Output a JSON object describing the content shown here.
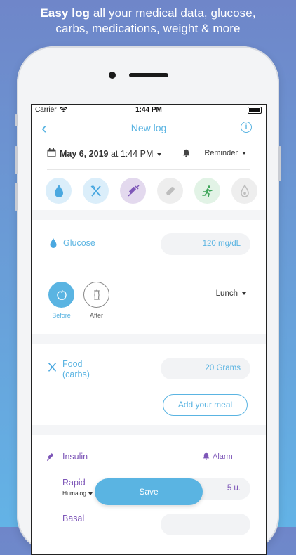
{
  "tagline": {
    "bold": "Easy log",
    "line1_rest": " all your medical data, glucose,",
    "line2": "carbs, medications, weight & more"
  },
  "status": {
    "carrier": "Carrier",
    "time": "1:44 PM"
  },
  "nav": {
    "back_glyph": "‹",
    "title": "New log",
    "info_glyph": "i"
  },
  "date": {
    "date_text": "May 6, 2019",
    "at_text": " at 1:44 PM",
    "reminder_label": "Reminder"
  },
  "categories": [
    {
      "icon": "drop-icon",
      "bg": "#dbeefa",
      "color": "#4aa8e0"
    },
    {
      "icon": "fork-knife-icon",
      "bg": "#dbeefa",
      "color": "#4aa8e0"
    },
    {
      "icon": "syringe-icon",
      "bg": "#e3d9ee",
      "color": "#7e57b8"
    },
    {
      "icon": "pill-icon",
      "bg": "#eeeeee",
      "color": "#bdbdbd"
    },
    {
      "icon": "running-icon",
      "bg": "#e2f3e6",
      "color": "#3fa65a"
    },
    {
      "icon": "drop-outline-icon",
      "bg": "#eeeeee",
      "color": "#bdbdbd"
    }
  ],
  "glucose": {
    "label": "Glucose",
    "value": "120 mg/dL",
    "before_label": "Before",
    "after_label": "After",
    "meal": "Lunch"
  },
  "food": {
    "label_line1": "Food",
    "label_line2": "(carbs)",
    "value": "20 Grams",
    "add_meal_label": "Add your meal"
  },
  "insulin": {
    "label": "Insulin",
    "alarm_label": "Alarm",
    "rapid_label": "Rapid",
    "rapid_brand": "Humalog",
    "rapid_value": "5 u.",
    "basal_label": "Basal"
  },
  "save_label": "Save",
  "colors": {
    "accent": "#5ab4e2",
    "insulin": "#7e57b8"
  }
}
